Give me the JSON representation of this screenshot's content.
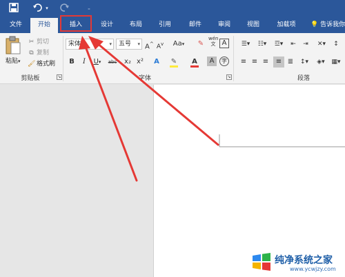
{
  "quick_access": {
    "save_icon": "save-icon",
    "undo_icon": "undo-icon",
    "redo_icon": "redo-icon",
    "customize_icon": "customize-qat-icon"
  },
  "tabs": [
    {
      "label": "文件"
    },
    {
      "label": "开始"
    },
    {
      "label": "插入"
    },
    {
      "label": "设计"
    },
    {
      "label": "布局"
    },
    {
      "label": "引用"
    },
    {
      "label": "邮件"
    },
    {
      "label": "审阅"
    },
    {
      "label": "视图"
    },
    {
      "label": "加载项"
    }
  ],
  "tell_me": "告诉我你",
  "clipboard": {
    "paste": "粘贴",
    "cut": "剪切",
    "copy": "复制",
    "format_painter": "格式刷",
    "group_label": "剪贴板"
  },
  "font": {
    "name": "宋体",
    "size": "五号",
    "grow": "A",
    "shrink": "A",
    "case": "Aa",
    "bold": "B",
    "italic": "I",
    "underline": "U",
    "strike": "abc",
    "subscript": "x₂",
    "superscript": "x²",
    "group_label": "字体"
  },
  "paragraph": {
    "group_label": "段落"
  },
  "watermark": {
    "title": "纯净系统之家",
    "url": "www.ycwjzy.com"
  },
  "colors": {
    "title_bar": "#2b579a",
    "ribbon": "#f3f3f3",
    "highlight": "#e53935",
    "workspace": "#e6e6e6"
  }
}
